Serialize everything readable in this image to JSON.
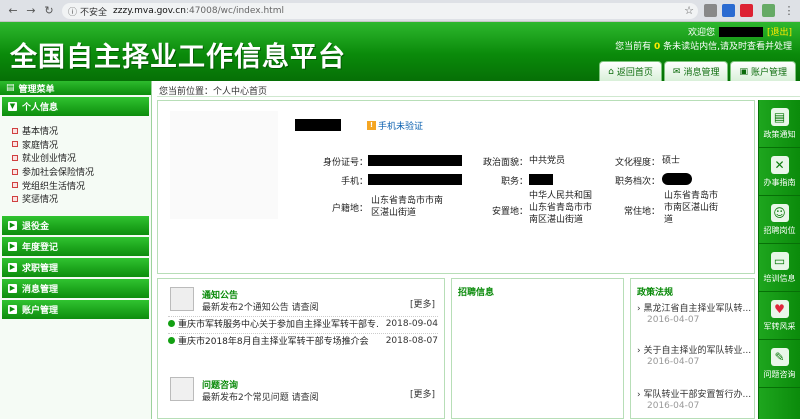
{
  "browser": {
    "insecure_label": "不安全",
    "url_host": "zzzy.mva.gov.cn",
    "url_rest": ":47008/wc/index.html"
  },
  "header": {
    "title": "全国自主择业工作信息平台",
    "welcome": "欢迎您",
    "logout": "[退出]",
    "msg_prefix": "您当前有",
    "msg_count": "0",
    "msg_suffix": "条未读站内信,请及时查看并处理",
    "nav": [
      "返回首页",
      "消息管理",
      "账户管理"
    ]
  },
  "sidebar": {
    "header": "管理菜单",
    "groups": [
      {
        "label": "个人信息",
        "items": [
          "基本情况",
          "家庭情况",
          "就业创业情况",
          "参加社会保险情况",
          "党组织生活情况",
          "奖惩情况"
        ]
      },
      {
        "label": "退役金"
      },
      {
        "label": "年度登记"
      },
      {
        "label": "求职管理"
      },
      {
        "label": "消息管理"
      },
      {
        "label": "账户管理"
      }
    ]
  },
  "breadcrumb": "您当前位置：个人中心首页",
  "profile": {
    "phone_status": "手机未验证",
    "fields": {
      "id_label": "身份证号：",
      "phone_label": "手机：",
      "hukou_label": "户籍地：",
      "hukou_value": "山东省青岛市市南区湛山街道",
      "politics_label": "政治面貌：",
      "politics_value": "中共党员",
      "job_label": "职务：",
      "placement_label": "安置地：",
      "placement_value": "中华人民共和国山东省青岛市市南区湛山街道",
      "edu_label": "文化程度：",
      "edu_value": "硕士",
      "archive_label": "职务档次：",
      "residence_label": "常住地：",
      "residence_value": "山东省青岛市市南区湛山街道"
    }
  },
  "notice": {
    "title": "通知公告",
    "subtitle": "最新发布2个通知公告 请查阅",
    "more": "[更多]",
    "items": [
      {
        "title": "重庆市军转服务中心关于参加自主择业军转干部专...",
        "date": "2018-09-04"
      },
      {
        "title": "重庆市2018年8月自主择业军转干部专场推介会",
        "date": "2018-08-07"
      }
    ]
  },
  "qa": {
    "title": "问题咨询",
    "subtitle": "最新发布2个常见问题 请查阅",
    "more": "[更多]"
  },
  "jobs": {
    "title": "招聘信息"
  },
  "policy": {
    "title": "政策法规",
    "items": [
      {
        "title": "黑龙江省自主择业军队转...",
        "date": "2016-04-07"
      },
      {
        "title": "关于自主择业的军队转业...",
        "date": "2016-04-07"
      },
      {
        "title": "军队转业干部安置暂行办...",
        "date": "2016-04-07"
      }
    ]
  },
  "rightbar": [
    "政策通知",
    "办事指南",
    "招聘岗位",
    "培训信息",
    "军转风采",
    "问题咨询"
  ]
}
